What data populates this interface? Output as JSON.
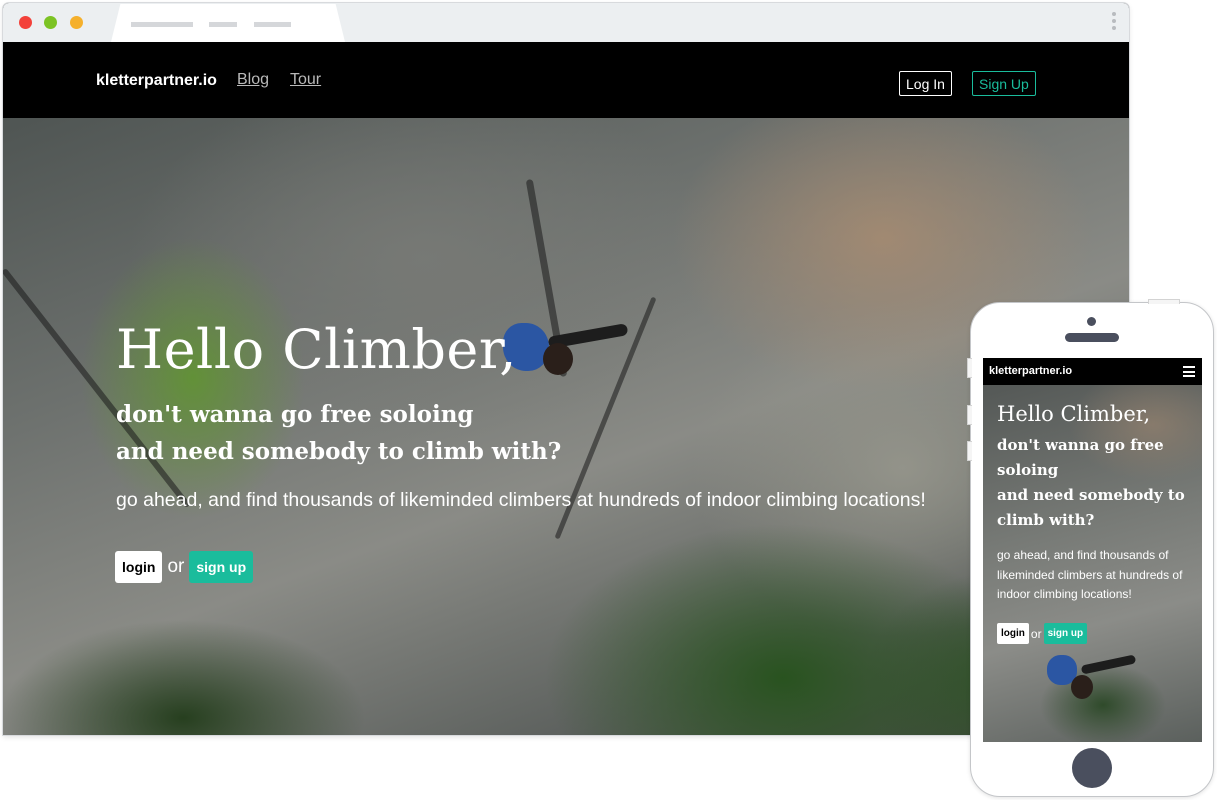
{
  "desktop": {
    "brand": "kletterpartner.io",
    "nav": {
      "blog": "Blog",
      "tour": "Tour",
      "login": "Log In",
      "signup": "Sign Up"
    },
    "hero": {
      "title": "Hello Climber,",
      "subtitle_line1": "don't wanna go free soloing",
      "subtitle_line2": "and need somebody to climb with?",
      "description": "go ahead, and find thousands of likeminded climbers at hundreds of indoor climbing locations!",
      "login_button": "login",
      "or_text": "or",
      "signup_button": "sign up"
    }
  },
  "mobile": {
    "brand": "kletterpartner.io",
    "hero": {
      "title": "Hello Climber,",
      "subtitle": "don't wanna go free soloing\nand need somebody to climb with?",
      "description": "go ahead, and find thousands of likeminded climbers at hundreds of indoor climbing locations!",
      "login_button": "login",
      "or_text": "or",
      "signup_button": "sign up"
    }
  },
  "colors": {
    "accent": "#1abc9c",
    "nav_background": "#000000",
    "browser_chrome": "#eceff1",
    "traffic_red": "#f3413a",
    "traffic_green": "#7cc324",
    "traffic_yellow": "#f5b02c",
    "phone_controls": "#4a4f5e"
  },
  "icons": {
    "menu": "hamburger-menu-icon",
    "browser_menu": "kebab-menu-icon"
  }
}
